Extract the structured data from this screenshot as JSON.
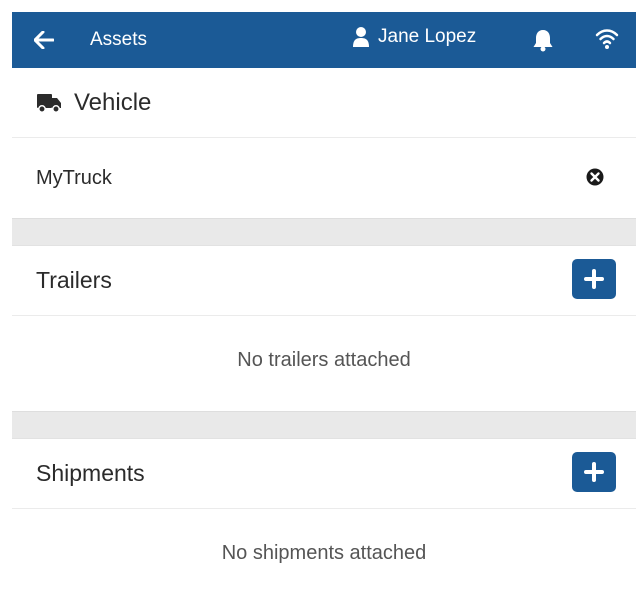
{
  "topbar": {
    "title": "Assets",
    "user_name": "Jane Lopez",
    "icons": [
      "back-arrow-icon",
      "user-icon",
      "bell-icon",
      "wifi-icon"
    ]
  },
  "vehicle": {
    "header": "Vehicle",
    "selected": "MyTruck",
    "icons": [
      "truck-icon",
      "clear-icon"
    ]
  },
  "trailers": {
    "header": "Trailers",
    "empty": "No trailers attached"
  },
  "shipments": {
    "header": "Shipments",
    "empty": "No shipments attached"
  },
  "colors": {
    "primary": "#1b5a96",
    "separator": "#e9e9e9",
    "muted_text": "#555555"
  }
}
